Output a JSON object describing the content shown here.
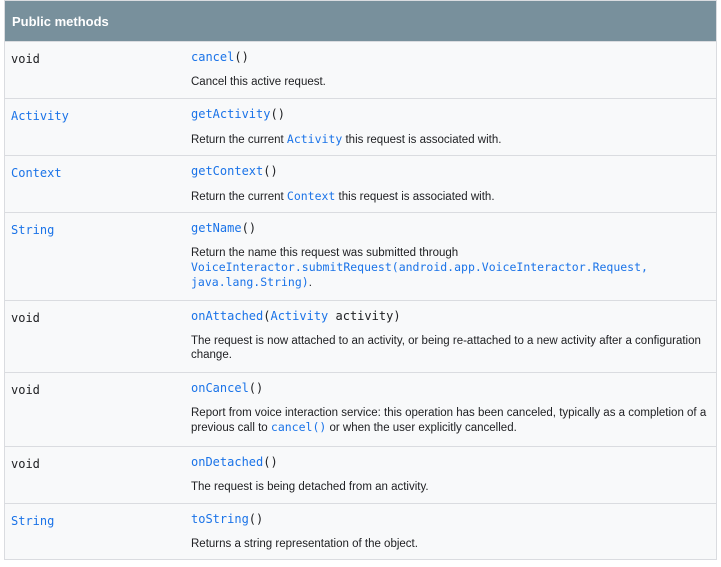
{
  "header": {
    "title": "Public methods"
  },
  "methods": [
    {
      "type": "void",
      "name": "cancel",
      "sig_open": "(",
      "sig_close": ")",
      "desc": "Cancel this active request."
    },
    {
      "type": "Activity",
      "name": "getActivity",
      "sig_open": "(",
      "sig_close": ")",
      "desc_pre": "Return the current ",
      "desc_code": "Activity",
      "desc_post": " this request is associated with."
    },
    {
      "type": "Context",
      "name": "getContext",
      "sig_open": "(",
      "sig_close": ")",
      "desc_pre": "Return the current ",
      "desc_code": "Context",
      "desc_post": " this request is associated with."
    },
    {
      "type": "String",
      "name": "getName",
      "sig_open": "(",
      "sig_close": ")",
      "desc_pre": "Return the name this request was submitted through",
      "desc_code_line1": "VoiceInteractor.submitRequest(android.app.VoiceInteractor.Request,",
      "desc_code_line2": "java.lang.String)",
      "desc_post": "."
    },
    {
      "type": "void",
      "name": "onAttached",
      "sig_open": "(",
      "param_type": "Activity",
      "param_name": " activity",
      "sig_close": ")",
      "desc": "The request is now attached to an activity, or being re-attached to a new activity after a configuration change."
    },
    {
      "type": "void",
      "name": "onCancel",
      "sig_open": "(",
      "sig_close": ")",
      "desc_pre": "Report from voice interaction service: this operation has been canceled, typically as a completion of a previous call to ",
      "desc_code": "cancel()",
      "desc_post": " or when the user explicitly cancelled."
    },
    {
      "type": "void",
      "name": "onDetached",
      "sig_open": "(",
      "sig_close": ")",
      "desc": "The request is being detached from an activity."
    },
    {
      "type": "String",
      "name": "toString",
      "sig_open": "(",
      "sig_close": ")",
      "desc": "Returns a string representation of the object."
    }
  ]
}
